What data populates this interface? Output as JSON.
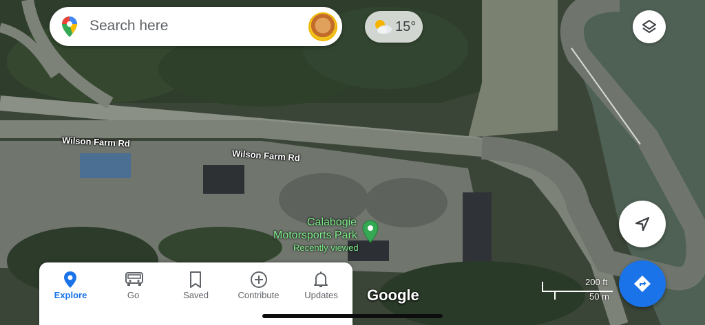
{
  "search": {
    "placeholder": "Search here",
    "logo_icon": "maps-pin-logo-icon",
    "mic_icon": "mic-icon"
  },
  "weather": {
    "icon": "partly-cloudy-icon",
    "temperature": "15°"
  },
  "map": {
    "roads": [
      {
        "label": "Wilson Farm Rd"
      },
      {
        "label": "Wilson Farm Rd"
      }
    ],
    "place": {
      "name_line1": "Calabogie",
      "name_line2": "Motorsports Park",
      "subtitle": "Recently viewed",
      "pin_color": "#34a853"
    },
    "scale": {
      "top": "200 ft",
      "bottom": "50 m"
    },
    "attribution": "Google"
  },
  "controls": {
    "layers_icon": "layers-icon",
    "location_icon": "navigation-arrow-icon",
    "directions_icon": "directions-icon"
  },
  "nav": {
    "items": [
      {
        "label": "Explore",
        "icon": "explore-pin-icon",
        "active": true
      },
      {
        "label": "Go",
        "icon": "car-icon",
        "active": false
      },
      {
        "label": "Saved",
        "icon": "bookmark-icon",
        "active": false
      },
      {
        "label": "Contribute",
        "icon": "plus-circle-icon",
        "active": false
      },
      {
        "label": "Updates",
        "icon": "bell-icon",
        "active": false
      }
    ]
  },
  "colors": {
    "accent": "#1a73e8",
    "place_label": "#7ff08c"
  }
}
